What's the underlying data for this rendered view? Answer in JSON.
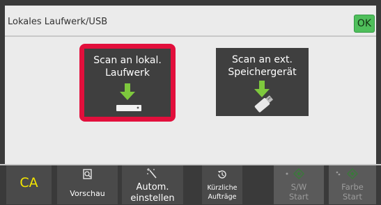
{
  "header": {
    "title": "Lokales Laufwerk/USB",
    "ok_label": "OK"
  },
  "destinations": {
    "local": {
      "line1": "Scan an lokal.",
      "line2": "Laufwerk"
    },
    "external": {
      "line1": "Scan an ext.",
      "line2": "Speichergerät"
    }
  },
  "footer": {
    "ca_label": "CA",
    "preview_label": "Vorschau",
    "auto_line1": "Autom.",
    "auto_line2": "einstellen",
    "recent_line1": "Kürzliche",
    "recent_line2": "Aufträge",
    "bw_line1": "S/W",
    "bw_line2": "Start",
    "color_line1": "Farbe",
    "color_line2": "Start"
  },
  "colors": {
    "ok": "#4fbf5b",
    "selection": "#e20f3c",
    "arrow": "#7ec83d",
    "ca_text": "#f4e600"
  },
  "icons": {
    "local": "download-to-drive-icon",
    "external": "download-to-usb-icon",
    "preview": "preview-icon",
    "auto": "magic-wand-icon",
    "recent": "recent-jobs-icon",
    "start": "start-diamond-icon"
  }
}
